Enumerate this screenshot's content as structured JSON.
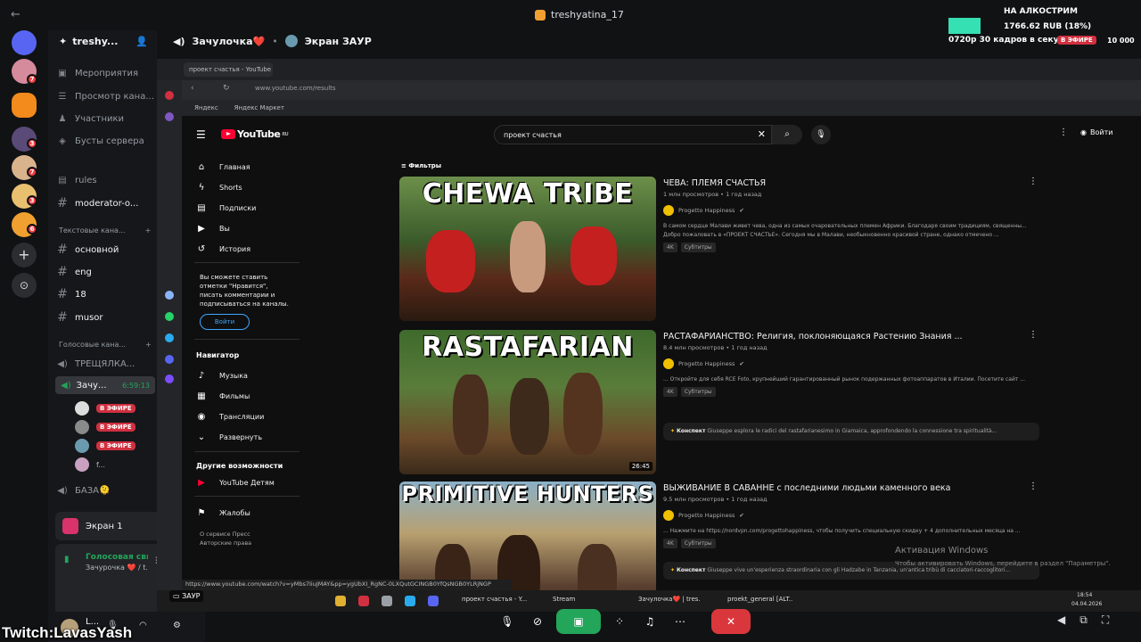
{
  "titlebar": {
    "title": "treshyatina_17",
    "back": "←"
  },
  "overlay": {
    "label": "НА АЛКОСТРИМ",
    "money": "1766.62 RUB (18%)",
    "quality": "0720p 30 кадров в секунду",
    "live": "В ЭФИРЕ",
    "count": "10 000"
  },
  "server": {
    "name": "treshy...",
    "channels_top": [
      {
        "icon": "calendar-icon",
        "label": "Мероприятия"
      },
      {
        "icon": "channels-icon",
        "label": "Просмотр кана..."
      },
      {
        "icon": "members-icon",
        "label": "Участники"
      },
      {
        "icon": "boost-icon",
        "label": "Бусты сервера"
      }
    ],
    "channels_mid": [
      {
        "label": "rules"
      },
      {
        "label": "moderator-o..."
      }
    ],
    "text_category": "Текстовые кана...",
    "text_channels": [
      "основной",
      "eng",
      "18",
      "musor"
    ],
    "voice_category": "Голосовые кана...",
    "voice_channel_1": "ТРЕЩЯЛКА...",
    "active_channel": "Зачу...",
    "active_time": "6:59:13",
    "voice_live": "В ЭФИРЕ",
    "voice_user4": "f...",
    "voice_channel_3": "БАЗА🫠",
    "screen_panel": "Экран 1",
    "vc_status": "Голосовая свя...",
    "vc_channel": "Зачурочка ❤️ / t...",
    "user": "L..."
  },
  "call_header": {
    "channel": "Зачулочка❤️",
    "screen_label": "Экран ЗАУР"
  },
  "browser": {
    "tab_title": "проект счастья - YouTube",
    "url": "www.youtube.com/results",
    "bookmarks": [
      "Яндекс",
      "Яндекс Маркет"
    ],
    "status_url": "https://www.youtube.com/watch?v=yMbs7IiuJMAY&pp=ygUbXI_RgNC-0LXQutGCINGB0YfQsNGB0YLRjNGP"
  },
  "youtube": {
    "logo": "YouTube",
    "region": "RU",
    "search_value": "проект счастья",
    "signin": "Войти",
    "nav": [
      {
        "icon": "home-icon",
        "label": "Главная"
      },
      {
        "icon": "shorts-icon",
        "label": "Shorts"
      },
      {
        "icon": "subscriptions-icon",
        "label": "Подписки"
      },
      {
        "icon": "you-icon",
        "label": "Вы"
      },
      {
        "icon": "history-icon",
        "label": "История"
      }
    ],
    "login_prompt": "Вы сможете ставить отметки \"Нравится\", писать комментарии и подписываться на каналы.",
    "nav_login": "Войти",
    "navigator_header": "Навигатор",
    "navigator": [
      {
        "icon": "music-icon",
        "label": "Музыка"
      },
      {
        "icon": "film-icon",
        "label": "Фильмы"
      },
      {
        "icon": "live-icon",
        "label": "Трансляции"
      },
      {
        "icon": "chevron-down-icon",
        "label": "Развернуть"
      }
    ],
    "more_header": "Другие возможности",
    "more": [
      {
        "icon": "youtube-kids-icon",
        "label": "YouTube Детям"
      }
    ],
    "report": "Жалобы",
    "footer": "О сервисе  Пресс\nАвторские права",
    "filters": "Фильтры",
    "videos": [
      {
        "thumb_title": "CHEWA TRIBE",
        "title": "ЧЕВА: ПЛЕМЯ СЧАСТЬЯ",
        "meta": "1 млн просмотров • 1 год назад",
        "channel": "Progetto Happiness",
        "desc": "В самом сердце Малави живет чева, одна из самых очаровательных племен Африки. Благодаря своим традициям, священны...",
        "desc2": "Добро пожаловать в «ПРОЕКТ СЧАСТЬЕ». Сегодня мы в Малави, необыкновенно красивой стране, однако отмечено ...",
        "tags": [
          "4K",
          "Субтитры"
        ],
        "duration": ""
      },
      {
        "thumb_title": "RASTAFARIAN",
        "title": "РАСТАФАРИАНСТВО: Религия, поклоняющаяся Растению Знания ...",
        "meta": "8.4 млн просмотров • 1 год назад",
        "channel": "Progetto Happiness",
        "desc": "... Откройте для себя RCE Foto, крупнейший гарантированный рынок подержанных фотоаппаратов в Италии. Посетите сайт ...",
        "desc2": "",
        "tags": [
          "4K",
          "Субтитры"
        ],
        "duration": "26:45",
        "konspekt": "Giuseppe esplora le radici del rastafarianesimo in Giamaica, approfondendo la connessione tra spiritualità..."
      },
      {
        "thumb_title": "PRIMITIVE HUNTERS",
        "title": "ВЫЖИВАНИЕ В САВАННЕ с последними людьми каменного века",
        "meta": "9.5 млн просмотров • 1 год назад",
        "channel": "Progetto Happiness",
        "desc": "... Нажмите на https://nordvpn.com/progettohappiness, чтобы получить специальную скидку + 4 дополнительных месяца на ...",
        "desc2": "",
        "tags": [
          "4K",
          "Субтитры"
        ],
        "duration": "",
        "konspekt": "Giuseppe vive un'esperienza straordinaria con gli Hadzabe in Tanzania, un'antica tribù di cacciatori-raccoglitori..."
      }
    ],
    "konspekt_label": "Конспект",
    "windows_activation": "Активация Windows",
    "windows_activation_sub": "Чтобы активировать Windows, перейдите в раздел \"Параметры\"."
  },
  "remote_taskbar": {
    "clock": "18:54",
    "date": "04.04.2026",
    "label_zaur": "ЗАУР",
    "taskbar_tab": "проект счастья - Y...",
    "stream_tab": "Stream",
    "discord_tab": "Зачулочка❤️ | tres...",
    "general_tab": "proekt_general [ALT..."
  },
  "twitch": "Twitch:LavasYash"
}
